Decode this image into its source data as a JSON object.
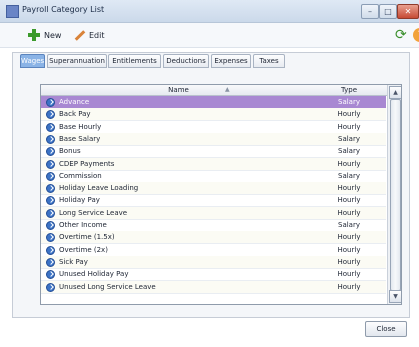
{
  "window": {
    "title": "Payroll Category List"
  },
  "toolbar": {
    "new_label": "New",
    "edit_label": "Edit"
  },
  "tabs": [
    {
      "label": "Wages",
      "active": true
    },
    {
      "label": "Superannuation"
    },
    {
      "label": "Entitlements"
    },
    {
      "label": "Deductions"
    },
    {
      "label": "Expenses"
    },
    {
      "label": "Taxes"
    }
  ],
  "grid": {
    "columns": {
      "name": "Name",
      "type": "Type"
    },
    "rows": [
      {
        "name": "Advance",
        "type": "Salary",
        "selected": true
      },
      {
        "name": "Back Pay",
        "type": "Hourly"
      },
      {
        "name": "Base Hourly",
        "type": "Hourly"
      },
      {
        "name": "Base Salary",
        "type": "Salary"
      },
      {
        "name": "Bonus",
        "type": "Salary"
      },
      {
        "name": "CDEP Payments",
        "type": "Hourly"
      },
      {
        "name": "Commission",
        "type": "Salary"
      },
      {
        "name": "Holiday Leave Loading",
        "type": "Hourly"
      },
      {
        "name": "Holiday Pay",
        "type": "Hourly"
      },
      {
        "name": "Long Service Leave",
        "type": "Hourly"
      },
      {
        "name": "Other Income",
        "type": "Salary"
      },
      {
        "name": "Overtime (1.5x)",
        "type": "Hourly"
      },
      {
        "name": "Overtime (2x)",
        "type": "Hourly"
      },
      {
        "name": "Sick Pay",
        "type": "Hourly"
      },
      {
        "name": "Unused Holiday Pay",
        "type": "Hourly"
      },
      {
        "name": "Unused Long Service Leave",
        "type": "Hourly"
      }
    ]
  },
  "footer": {
    "close_label": "Close"
  },
  "colors": {
    "selected_row": "#a888d2",
    "active_tab": "#8ab3e6"
  }
}
